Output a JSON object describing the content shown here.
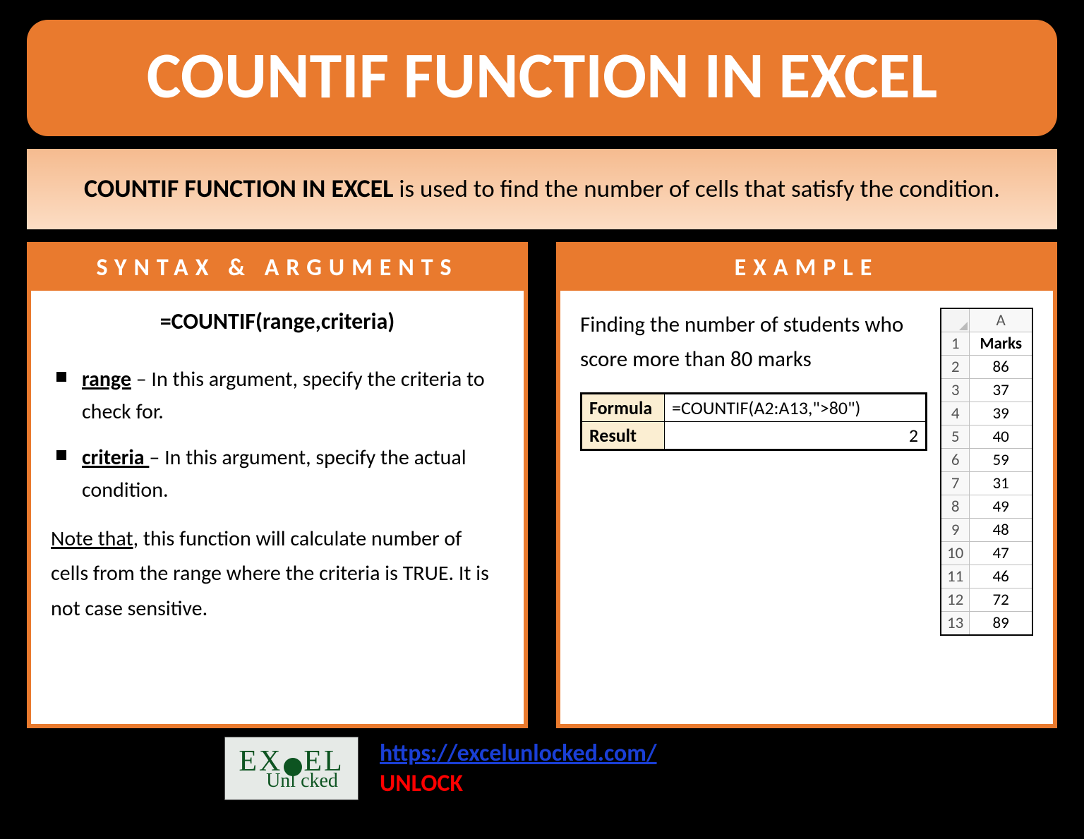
{
  "title": "COUNTIF FUNCTION IN EXCEL",
  "description": {
    "intro_bold": "COUNTIF FUNCTION IN EXCEL",
    "rest": " is used to find the number of cells that satisfy the condition."
  },
  "syntax": {
    "header": "SYNTAX & ARGUMENTS",
    "formula": "=COUNTIF(range,criteria)",
    "args": [
      {
        "name": "range",
        "desc": " – In this argument, specify the criteria to check for."
      },
      {
        "name": "criteria ",
        "desc": "– In this argument, specify the actual condition."
      }
    ],
    "note_underline": "Note that",
    "note_rest": ", this function will calculate number of cells from the range where the criteria is TRUE. It is not case sensitive."
  },
  "example": {
    "header": "EXAMPLE",
    "prompt": "Finding the number of students who score more than 80 marks",
    "formula_label": "Formula",
    "formula_value": "=COUNTIF(A2:A13,\">80\")",
    "result_label": "Result",
    "result_value": "2",
    "sheet": {
      "col_label": "A",
      "header": "Marks",
      "rows": [
        {
          "n": "1"
        },
        {
          "n": "2",
          "v": "86"
        },
        {
          "n": "3",
          "v": "37"
        },
        {
          "n": "4",
          "v": "39"
        },
        {
          "n": "5",
          "v": "40"
        },
        {
          "n": "6",
          "v": "59"
        },
        {
          "n": "7",
          "v": "31"
        },
        {
          "n": "8",
          "v": "49"
        },
        {
          "n": "9",
          "v": "48"
        },
        {
          "n": "10",
          "v": "47"
        },
        {
          "n": "11",
          "v": "46"
        },
        {
          "n": "12",
          "v": "72"
        },
        {
          "n": "13",
          "v": "89"
        }
      ]
    }
  },
  "footer": {
    "logo_top_1": "EX",
    "logo_top_2": "EL",
    "logo_bottom": "Unl   cked",
    "url": "https://excelunlocked.com/",
    "tag": "UNLOCK"
  }
}
